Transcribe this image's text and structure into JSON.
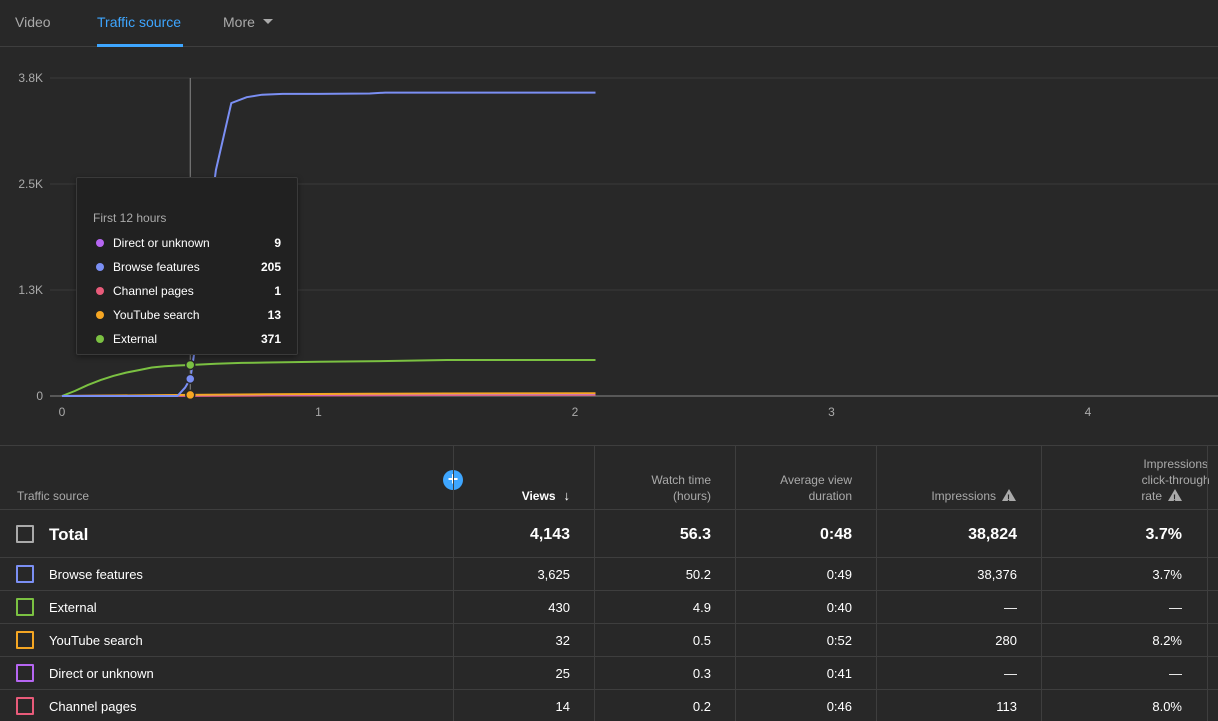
{
  "tabs": [
    {
      "label": "Video"
    },
    {
      "label": "Traffic source"
    },
    {
      "label": "More"
    }
  ],
  "chart_data": {
    "type": "line",
    "xlabel": "",
    "ylabel": "",
    "x_ticks": [
      "0",
      "1",
      "2",
      "3",
      "4"
    ],
    "y_ticks": [
      "0",
      "1.3K",
      "2.5K",
      "3.8K"
    ],
    "xlim": [
      0,
      4.6
    ],
    "ylim": [
      0,
      3800
    ],
    "grid": true,
    "series": [
      {
        "name": "Browse features",
        "color": "#7b8ff4",
        "x": [
          0,
          0.45,
          0.48,
          0.5,
          0.52,
          0.55,
          0.6,
          0.66,
          0.72,
          0.78,
          0.86,
          1.0,
          1.2,
          1.26,
          1.5,
          1.8,
          2.08
        ],
        "y": [
          0,
          0,
          100,
          205,
          600,
          1500,
          2700,
          3500,
          3570,
          3600,
          3610,
          3610,
          3615,
          3625,
          3625,
          3625,
          3625
        ]
      },
      {
        "name": "External",
        "color": "#7bc142",
        "x": [
          0,
          0.05,
          0.1,
          0.15,
          0.2,
          0.25,
          0.3,
          0.35,
          0.4,
          0.45,
          0.5,
          0.6,
          0.7,
          0.8,
          0.9,
          1.0,
          1.2,
          1.5,
          1.8,
          2.08
        ],
        "y": [
          0,
          60,
          130,
          190,
          240,
          280,
          310,
          340,
          355,
          365,
          371,
          385,
          395,
          400,
          405,
          410,
          415,
          430,
          430,
          430
        ]
      },
      {
        "name": "Direct or unknown",
        "color": "#b666f2",
        "x": [
          0,
          0.5,
          0.8,
          1.2,
          1.5,
          2.08
        ],
        "y": [
          0,
          9,
          15,
          20,
          23,
          25
        ]
      },
      {
        "name": "YouTube search",
        "color": "#f5a623",
        "x": [
          0,
          0.5,
          0.8,
          1.2,
          1.5,
          2.08
        ],
        "y": [
          0,
          13,
          20,
          26,
          30,
          32
        ]
      },
      {
        "name": "Channel pages",
        "color": "#e85b7a",
        "x": [
          0,
          0.5,
          0.8,
          1.2,
          1.5,
          2.08
        ],
        "y": [
          0,
          1,
          6,
          10,
          12,
          14
        ]
      }
    ],
    "cursor_x": 0.5
  },
  "tooltip": {
    "title": "First 12 hours",
    "rows": [
      {
        "name": "Direct or unknown",
        "value": "9",
        "color": "#b666f2"
      },
      {
        "name": "Browse features",
        "value": "205",
        "color": "#7b8ff4"
      },
      {
        "name": "Channel pages",
        "value": "1",
        "color": "#e85b7a"
      },
      {
        "name": "YouTube search",
        "value": "13",
        "color": "#f5a623"
      },
      {
        "name": "External",
        "value": "371",
        "color": "#7bc142"
      }
    ]
  },
  "table": {
    "headers": {
      "source": "Traffic source",
      "views": "Views",
      "watch_time_1": "Watch time",
      "watch_time_2": "(hours)",
      "avg_1": "Average view",
      "avg_2": "duration",
      "impressions": "Impressions",
      "ctr_1": "Impressions",
      "ctr_2": "click-through",
      "ctr_3": "rate"
    },
    "add_icon": "+",
    "sort_icon": "↓",
    "total": {
      "label": "Total",
      "views": "4,143",
      "watch": "56.3",
      "avg": "0:48",
      "impr": "38,824",
      "ctr": "3.7%"
    },
    "rows": [
      {
        "label": "Browse features",
        "color": "#7b8ff4",
        "views": "3,625",
        "watch": "50.2",
        "avg": "0:49",
        "impr": "38,376",
        "ctr": "3.7%"
      },
      {
        "label": "External",
        "color": "#7bc142",
        "views": "430",
        "watch": "4.9",
        "avg": "0:40",
        "impr": "—",
        "ctr": "—"
      },
      {
        "label": "YouTube search",
        "color": "#f5a623",
        "views": "32",
        "watch": "0.5",
        "avg": "0:52",
        "impr": "280",
        "ctr": "8.2%"
      },
      {
        "label": "Direct or unknown",
        "color": "#b666f2",
        "views": "25",
        "watch": "0.3",
        "avg": "0:41",
        "impr": "—",
        "ctr": "—"
      },
      {
        "label": "Channel pages",
        "color": "#e85b7a",
        "views": "14",
        "watch": "0.2",
        "avg": "0:46",
        "impr": "113",
        "ctr": "8.0%"
      }
    ]
  }
}
